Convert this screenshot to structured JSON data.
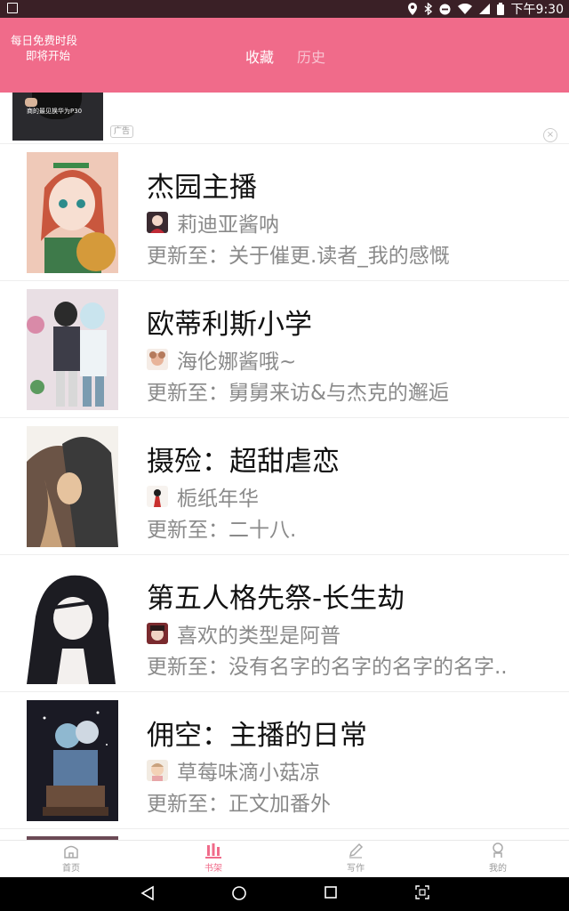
{
  "status_bar": {
    "time": "下午9:30"
  },
  "header": {
    "free_line1": "每日免费时段",
    "free_line2": "即将开始",
    "tabs": [
      {
        "label": "收藏",
        "active": true
      },
      {
        "label": "历史",
        "active": false
      }
    ]
  },
  "ad": {
    "caption": "商的最见换华为P30",
    "badge": "广告",
    "close": "×"
  },
  "books": [
    {
      "title": "杰园主播",
      "author": "莉迪亚酱呐",
      "update": "更新至：关于催更.读者_我的感慨"
    },
    {
      "title": "欧蒂利斯小学",
      "author": "海伦娜酱哦~",
      "update": "更新至：舅舅来访&与杰克的邂逅"
    },
    {
      "title": "摄殓：超甜虐恋",
      "author": "栀纸年华",
      "update": "更新至：二十八."
    },
    {
      "title": "第五人格先祭-长生劫",
      "author": "喜欢的类型是阿普",
      "update": "更新至：没有名字的名字的名字的名字.."
    },
    {
      "title": "佣空：主播的日常",
      "author": "草莓味滴小菇凉",
      "update": "更新至：正文加番外"
    }
  ],
  "bottom_nav": [
    {
      "label": "首页",
      "icon": "home-icon",
      "active": false
    },
    {
      "label": "书架",
      "icon": "bookshelf-icon",
      "active": true
    },
    {
      "label": "写作",
      "icon": "pen-icon",
      "active": false
    },
    {
      "label": "我的",
      "icon": "profile-icon",
      "active": false
    }
  ],
  "colors": {
    "accent": "#f06b8a",
    "status_bar": "#3a2026"
  }
}
